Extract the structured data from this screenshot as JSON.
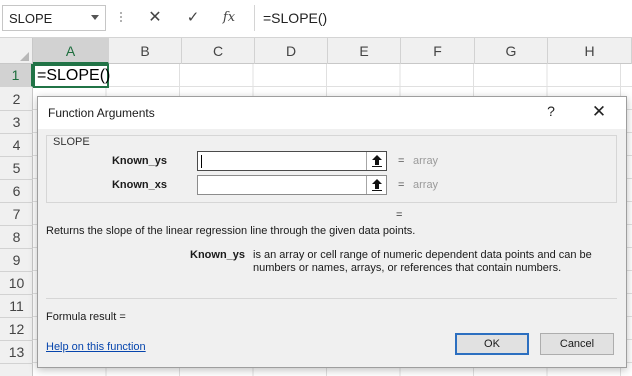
{
  "formula_bar": {
    "name_box": "SLOPE",
    "cancel_icon": "close-icon",
    "enter_icon": "checkmark-icon",
    "fx_label": "fx",
    "formula": "=SLOPE()"
  },
  "grid": {
    "columns": [
      "A",
      "B",
      "C",
      "D",
      "E",
      "F",
      "G",
      "H"
    ],
    "active_column": "A",
    "rows": [
      "1",
      "2",
      "3",
      "4",
      "5",
      "6",
      "7",
      "8",
      "9",
      "10",
      "11",
      "12",
      "13"
    ],
    "active_row": "1",
    "active_cell_text": "=SLOPE()"
  },
  "dialog": {
    "title": "Function Arguments",
    "help_label": "?",
    "close_label": "✕",
    "function_name": "SLOPE",
    "arguments": [
      {
        "label": "Known_ys",
        "value": "",
        "eq": "=",
        "type_hint": "array"
      },
      {
        "label": "Known_xs",
        "value": "",
        "eq": "=",
        "type_hint": "array"
      }
    ],
    "result_eq": "=",
    "description": "Returns the slope of the linear regression line through the given data points.",
    "arg_desc_name": "Known_ys",
    "arg_desc_text": "is an array or cell range of numeric dependent data points and can be numbers or names, arrays, or references that contain numbers.",
    "formula_result_label": "Formula result =",
    "help_link": "Help on this function",
    "ok_label": "OK",
    "cancel_label": "Cancel"
  }
}
